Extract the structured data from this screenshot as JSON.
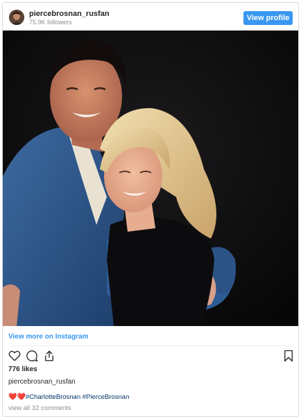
{
  "header": {
    "username": "piercebrosnan_rusfan",
    "followers": "75.9K followers",
    "view_profile_label": "View profile"
  },
  "photo": {
    "description_hidden": ""
  },
  "view_more_label": "View more on Instagram",
  "actions": {
    "icons": [
      "heart-icon",
      "comment-icon",
      "share-icon",
      "bookmark-icon"
    ]
  },
  "likes": "776 likes",
  "caption": {
    "username": "piercebrosnan_rusfan",
    "hearts": "❤️❤️",
    "text": "#CharlotteBrosnan #PierceBrosnan"
  },
  "comments_link": "view all 32 comments",
  "colors": {
    "accent": "#3897f0",
    "link": "#003569",
    "muted": "#8e8e8e"
  }
}
